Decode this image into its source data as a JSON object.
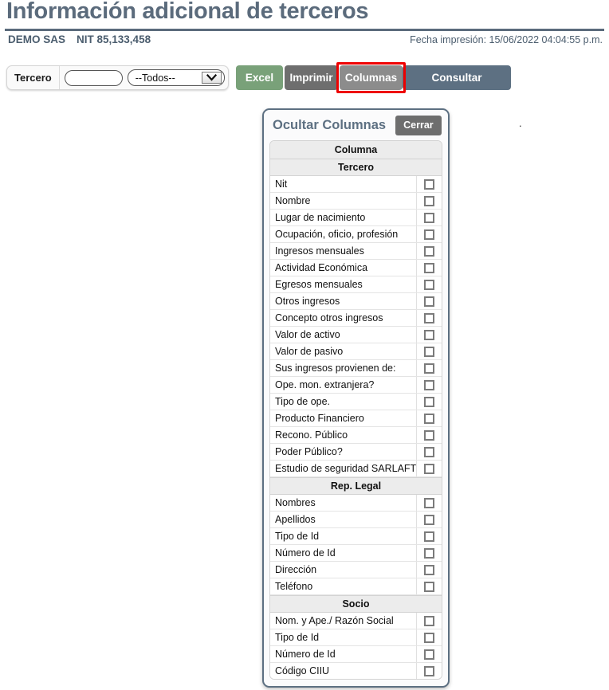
{
  "header": {
    "title": "Información adicional de terceros",
    "company": "DEMO SAS",
    "nit": "NIT 85,133,458",
    "print_date": "Fecha impresión: 15/06/2022 04:04:55 p.m."
  },
  "toolbar": {
    "filter_label": "Tercero",
    "tercero_value": "",
    "tercero_placeholder": "",
    "tipo_selected": "--Todos--",
    "tipo_options": [
      "--Todos--"
    ],
    "buttons": {
      "excel": "Excel",
      "imprimir": "Imprimir",
      "columnas": "Columnas",
      "consultar": "Consultar"
    },
    "highlight_color": "#ee0000",
    "colors": {
      "excel": "#79a179",
      "imprimir": "#6e6e6e",
      "columnas": "#8c8c8c",
      "consultar": "#5d7082"
    }
  },
  "stray_mark": ".",
  "panel": {
    "title": "Ocultar Columnas",
    "close_label": "Cerrar",
    "table_header": "Columna",
    "accent_color": "#5d7082",
    "groups": [
      {
        "name": "Tercero",
        "items": [
          {
            "label": "Nit",
            "checked": false
          },
          {
            "label": "Nombre",
            "checked": false
          },
          {
            "label": "Lugar de nacimiento",
            "checked": false
          },
          {
            "label": "Ocupación, oficio, profesión",
            "checked": false
          },
          {
            "label": "Ingresos mensuales",
            "checked": false
          },
          {
            "label": "Actividad Económica",
            "checked": false
          },
          {
            "label": "Egresos mensuales",
            "checked": false
          },
          {
            "label": "Otros ingresos",
            "checked": false
          },
          {
            "label": "Concepto otros ingresos",
            "checked": false
          },
          {
            "label": "Valor de activo",
            "checked": false
          },
          {
            "label": "Valor de pasivo",
            "checked": false
          },
          {
            "label": "Sus ingresos provienen de:",
            "checked": false
          },
          {
            "label": "Ope. mon. extranjera?",
            "checked": false
          },
          {
            "label": "Tipo de ope.",
            "checked": false
          },
          {
            "label": "Producto Financiero",
            "checked": false
          },
          {
            "label": "Recono. Público",
            "checked": false
          },
          {
            "label": "Poder Público?",
            "checked": false
          },
          {
            "label": "Estudio de seguridad SARLAFT",
            "checked": false
          }
        ]
      },
      {
        "name": "Rep. Legal",
        "items": [
          {
            "label": "Nombres",
            "checked": false
          },
          {
            "label": "Apellidos",
            "checked": false
          },
          {
            "label": "Tipo de Id",
            "checked": false
          },
          {
            "label": "Número de Id",
            "checked": false
          },
          {
            "label": "Dirección",
            "checked": false
          },
          {
            "label": "Teléfono",
            "checked": false
          }
        ]
      },
      {
        "name": "Socio",
        "items": [
          {
            "label": "Nom. y Ape./ Razón Social",
            "checked": false
          },
          {
            "label": "Tipo de Id",
            "checked": false
          },
          {
            "label": "Número de Id",
            "checked": false
          },
          {
            "label": "Código CIIU",
            "checked": false
          }
        ]
      }
    ]
  }
}
